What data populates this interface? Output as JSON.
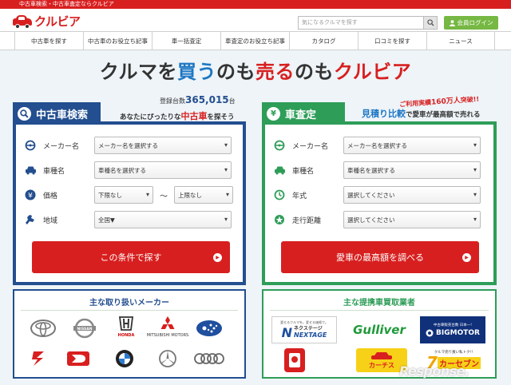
{
  "topbar": {
    "text": "中古車検索・中古車査定ならクルビア"
  },
  "header": {
    "logo_text": "クルビア",
    "search_placeholder": "気になるクルマを探す",
    "login_label": "会員ログイン"
  },
  "nav": {
    "items": [
      {
        "label": "中古車を探す"
      },
      {
        "label": "中古車のお役立ち記事"
      },
      {
        "label": "車一括査定"
      },
      {
        "label": "車査定のお役立ち記事"
      },
      {
        "label": "カタログ"
      },
      {
        "label": "口コミを探す"
      },
      {
        "label": "ニュース"
      }
    ]
  },
  "headline": {
    "p1": "クルマを",
    "p2": "買う",
    "p3": "のも",
    "p4": "売る",
    "p5": "のも",
    "p6": "クルビア"
  },
  "used_search": {
    "tab_label": "中古車検索",
    "count_label": "登録台数",
    "count_value": "365,015",
    "count_unit": "台",
    "subtag_pre": "あなたにぴったりな",
    "subtag_hl": "中古車",
    "subtag_post": "を探そう",
    "rows": {
      "maker": {
        "label": "メーカー名",
        "value": "メーカー名を選択する"
      },
      "model": {
        "label": "車種名",
        "value": "車種名を選択する"
      },
      "price": {
        "label": "価格",
        "min": "下限なし",
        "tilde": "〜",
        "max": "上限なし"
      },
      "area": {
        "label": "地域",
        "value": "全国▼"
      }
    },
    "cta_label": "この条件で探す"
  },
  "appraisal": {
    "tab_label": "車査定",
    "tab_icon": "¥",
    "users_pre": "ご利用実績",
    "users_value": "160万人",
    "users_post": "突破!!",
    "subtag_hl": "見積り比較",
    "subtag_post": "で愛車が最高額で売れる",
    "rows": {
      "maker": {
        "label": "メーカー名",
        "value": "メーカー名を選択する"
      },
      "model": {
        "label": "車種名",
        "value": "車種名を選択する"
      },
      "year": {
        "label": "年式",
        "value": "選択してください"
      },
      "mileage": {
        "label": "走行距離",
        "value": "選択してください"
      }
    },
    "cta_label": "愛車の最高額を調べる"
  },
  "makers_box": {
    "title": "主な取り扱いメーカー",
    "captions": {
      "honda": "HONDA",
      "mitsubishi": "MITSUBISHI MOTORS"
    }
  },
  "dealers_box": {
    "title": "主な提携車買取業者",
    "nextage_tag": "愛せるクルマを。愛せる価格で。",
    "nextage_jp": "ネクステージ",
    "nextage_en": "NEXTAGE",
    "gulliver": "Gulliver",
    "bigmotor_tag": "中古車販売台数 日本一!",
    "bigmotor": "BIGMOTOR",
    "carchs": "カーチス",
    "carseven_tag": "クルマ売り買い私トク!!",
    "carseven": "カーセブン"
  },
  "watermark": {
    "text": "Response."
  },
  "colors": {
    "brand_red": "#d81f1f",
    "navy": "#234e8f",
    "green": "#2e9d58",
    "blue": "#1d77c4"
  }
}
